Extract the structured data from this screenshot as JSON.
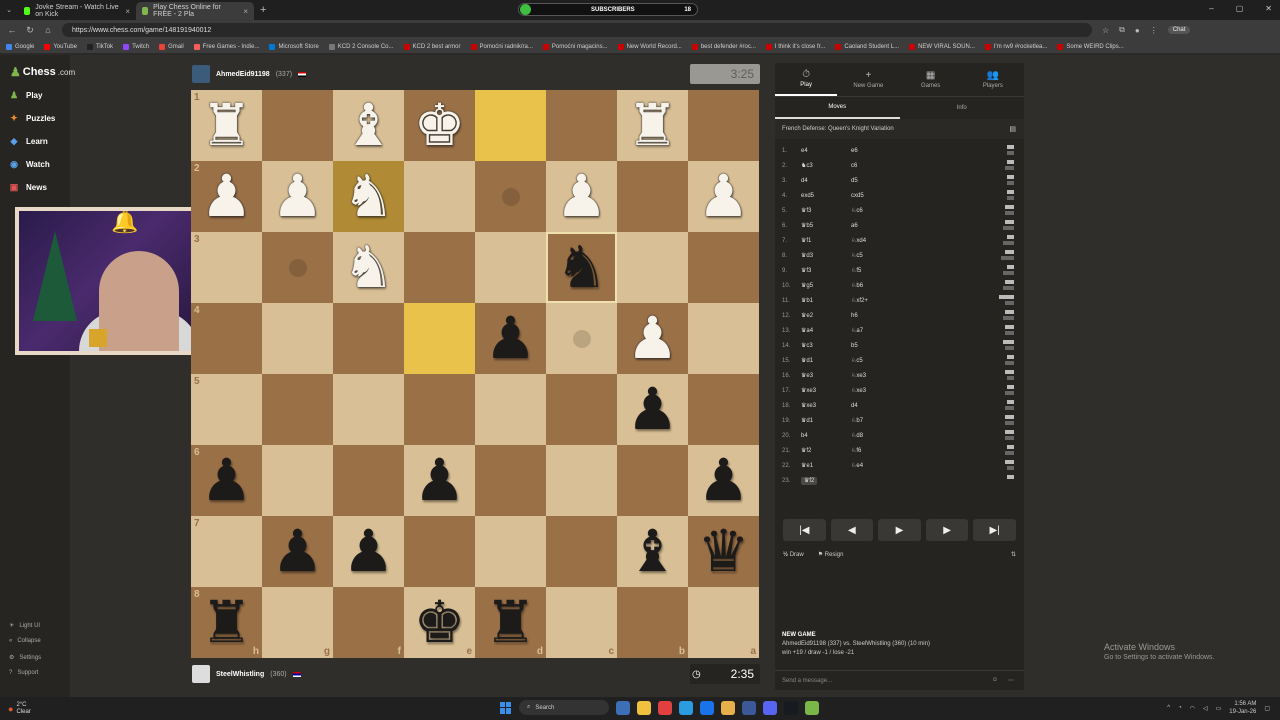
{
  "browser": {
    "tabs": [
      {
        "label": "Jovke Stream - Watch Live on Kick",
        "color": "#53fc18"
      },
      {
        "label": "Play Chess Online for FREE - 2 Pla",
        "color": "#81b64c"
      }
    ],
    "subs_label": "SUBSCRIBERS",
    "subs_count": "18",
    "url": "https://www.chess.com/game/148191940012",
    "chat_label": "Chat",
    "bookmarks": [
      {
        "label": "Google",
        "color": "#4285f4"
      },
      {
        "label": "YouTube",
        "color": "#ff0000"
      },
      {
        "label": "TikTok",
        "color": "#222"
      },
      {
        "label": "Twitch",
        "color": "#9146ff"
      },
      {
        "label": "Gmail",
        "color": "#ea4335"
      },
      {
        "label": "Free Games - Indie...",
        "color": "#fa5c5c"
      },
      {
        "label": "Microsoft Store",
        "color": "#0078d4"
      },
      {
        "label": "KCD 2 Console Co...",
        "color": "#777"
      },
      {
        "label": "KCD 2 best armor",
        "color": "#cc0000"
      },
      {
        "label": "Pomoćni radnik/ra...",
        "color": "#cc0000"
      },
      {
        "label": "Pomoćni magacins...",
        "color": "#cc0000"
      },
      {
        "label": "New World Record...",
        "color": "#cc0000"
      },
      {
        "label": "best defender #roc...",
        "color": "#cc0000"
      },
      {
        "label": "I think it's close fr...",
        "color": "#cc0000"
      },
      {
        "label": "Caoland Student L...",
        "color": "#cc0000"
      },
      {
        "label": "NEW VIRAL SOUN...",
        "color": "#cc0000"
      },
      {
        "label": "I'm rw9 #rocketlea...",
        "color": "#cc0000"
      },
      {
        "label": "Some WEIRD Clips...",
        "color": "#cc0000"
      }
    ]
  },
  "sidebar": {
    "logo_main": "Chess",
    "logo_suffix": ".com",
    "items": [
      {
        "label": "Play",
        "color": "#81b64c",
        "icon": "♟"
      },
      {
        "label": "Puzzles",
        "color": "#f28c28",
        "icon": "✦"
      },
      {
        "label": "Learn",
        "color": "#5aa0e6",
        "icon": "◆"
      },
      {
        "label": "Watch",
        "color": "#5aa0e6",
        "icon": "◉"
      },
      {
        "label": "News",
        "color": "#e05555",
        "icon": "▣"
      }
    ],
    "footer": [
      {
        "label": "Light UI",
        "icon": "☀"
      },
      {
        "label": "Collapse",
        "icon": "«"
      },
      {
        "label": "Settings",
        "icon": "⚙"
      },
      {
        "label": "Support",
        "icon": "?"
      }
    ]
  },
  "opponent": {
    "name": "AhmedEid91198",
    "rating": "(337)",
    "clock": "3:25"
  },
  "player": {
    "name": "SteelWhistling",
    "rating": "(360)",
    "clock": "2:35"
  },
  "board": {
    "rank_labels": [
      "1",
      "2",
      "3",
      "4",
      "5",
      "6",
      "7",
      "8"
    ],
    "file_labels": [
      "h",
      "g",
      "f",
      "e",
      "d",
      "c",
      "b",
      "a"
    ],
    "rows": [
      [
        "wR",
        "",
        "wB",
        "wK",
        "",
        "",
        "wR",
        ""
      ],
      [
        "wP",
        "wP",
        "wN",
        "",
        "",
        "wP",
        "",
        "wP"
      ],
      [
        "",
        "",
        "wN",
        "",
        "",
        "bN",
        "",
        ""
      ],
      [
        "",
        "",
        "",
        "",
        "bP",
        "",
        "wP",
        ""
      ],
      [
        "",
        "",
        "",
        "",
        "",
        "",
        "bP",
        ""
      ],
      [
        "bP",
        "",
        "",
        "bP",
        "",
        "",
        "",
        "bP"
      ],
      [
        "",
        "bP",
        "bP",
        "",
        "",
        "",
        "bB",
        "bQ"
      ],
      [
        "bR",
        "",
        "",
        "bK",
        "bR",
        "",
        "",
        ""
      ]
    ],
    "highlight": [
      [
        0,
        4
      ],
      [
        3,
        3
      ],
      [
        1,
        2
      ]
    ],
    "selected": [
      2,
      5
    ],
    "hints": [
      [
        1,
        4
      ],
      [
        2,
        1
      ],
      [
        3,
        5
      ]
    ]
  },
  "panel": {
    "tabs": [
      {
        "label": "Play",
        "icon": "⏱"
      },
      {
        "label": "New Game",
        "icon": "+"
      },
      {
        "label": "Games",
        "icon": "▦"
      },
      {
        "label": "Players",
        "icon": "👥"
      }
    ],
    "subtabs": [
      "Moves",
      "Info"
    ],
    "opening": "French Defense: Queen's Knight Variation",
    "moves": [
      {
        "n": "1.",
        "w": "e4",
        "b": "e6",
        "wt": 0.3,
        "bt": 0.3
      },
      {
        "n": "2.",
        "w": "♞c3",
        "b": "c6",
        "wt": 0.3,
        "bt": 0.4
      },
      {
        "n": "3.",
        "w": "d4",
        "b": "d5",
        "wt": 0.3,
        "bt": 0.3
      },
      {
        "n": "4.",
        "w": "exd5",
        "b": "cxd5",
        "wt": 0.3,
        "bt": 0.3
      },
      {
        "n": "5.",
        "w": "♛f3",
        "b": "♘c6",
        "wt": 0.4,
        "bt": 0.4
      },
      {
        "n": "6.",
        "w": "♛b5",
        "b": "a6",
        "wt": 0.4,
        "bt": 0.5
      },
      {
        "n": "7.",
        "w": "♛f1",
        "b": "♘xd4",
        "wt": 0.3,
        "bt": 0.5
      },
      {
        "n": "8.",
        "w": "♛d3",
        "b": "♘c5",
        "wt": 0.4,
        "bt": 0.6
      },
      {
        "n": "9.",
        "w": "♛f3",
        "b": "♘f5",
        "wt": 0.3,
        "bt": 0.5
      },
      {
        "n": "10.",
        "w": "♛g5",
        "b": "♘b6",
        "wt": 0.4,
        "bt": 0.5
      },
      {
        "n": "11.",
        "w": "♛b1",
        "b": "♘xf2+",
        "wt": 0.7,
        "bt": 0.4
      },
      {
        "n": "12.",
        "w": "♛e2",
        "b": "h6",
        "wt": 0.4,
        "bt": 0.5
      },
      {
        "n": "13.",
        "w": "♛a4",
        "b": "♘a7",
        "wt": 0.4,
        "bt": 0.4
      },
      {
        "n": "14.",
        "w": "♛c3",
        "b": "b5",
        "wt": 0.5,
        "bt": 0.4
      },
      {
        "n": "15.",
        "w": "♛d1",
        "b": "♘c5",
        "wt": 0.3,
        "bt": 0.4
      },
      {
        "n": "16.",
        "w": "♛e3",
        "b": "♘xe3",
        "wt": 0.4,
        "bt": 0.3
      },
      {
        "n": "17.",
        "w": "♛xe3",
        "b": "♘xe3",
        "wt": 0.3,
        "bt": 0.4
      },
      {
        "n": "18.",
        "w": "♛xe3",
        "b": "d4",
        "wt": 0.3,
        "bt": 0.4
      },
      {
        "n": "19.",
        "w": "♛d1",
        "b": "♘b7",
        "wt": 0.4,
        "bt": 0.4
      },
      {
        "n": "20.",
        "w": "b4",
        "b": "♘d8",
        "wt": 0.4,
        "bt": 0.4
      },
      {
        "n": "21.",
        "w": "♛f2",
        "b": "♘f6",
        "wt": 0.3,
        "bt": 0.4
      },
      {
        "n": "22.",
        "w": "♛e1",
        "b": "♘e4",
        "wt": 0.4,
        "bt": 0.3
      },
      {
        "n": "23.",
        "w": "♛f2",
        "b": "",
        "wt": 0.3,
        "bt": 0
      }
    ],
    "controls": [
      "|◀",
      "◀",
      "▶",
      "▶",
      "▶|"
    ],
    "draw_label": "Draw",
    "resign_label": "Resign",
    "newgame_title": "NEW GAME",
    "newgame_line1": "AhmedEid91198 (337) vs. SteelWhistling (360) (10 min)",
    "newgame_line2": "win +19 / draw -1 / lose -21",
    "message_placeholder": "Send a message..."
  },
  "activate": {
    "title": "Activate Windows",
    "subtitle": "Go to Settings to activate Windows."
  },
  "taskbar": {
    "weather_temp": "2°C",
    "weather_cond": "Clear",
    "search_label": "Search",
    "time": "1:56 AM",
    "date": "19-Jan-26",
    "apps": [
      "#3d6fb6",
      "#f0c040",
      "#e04040",
      "#2a9de0",
      "#1a73e8",
      "#e8b04a",
      "#3b5998",
      "#5865f2",
      "#171a21",
      "#7ab648"
    ]
  }
}
